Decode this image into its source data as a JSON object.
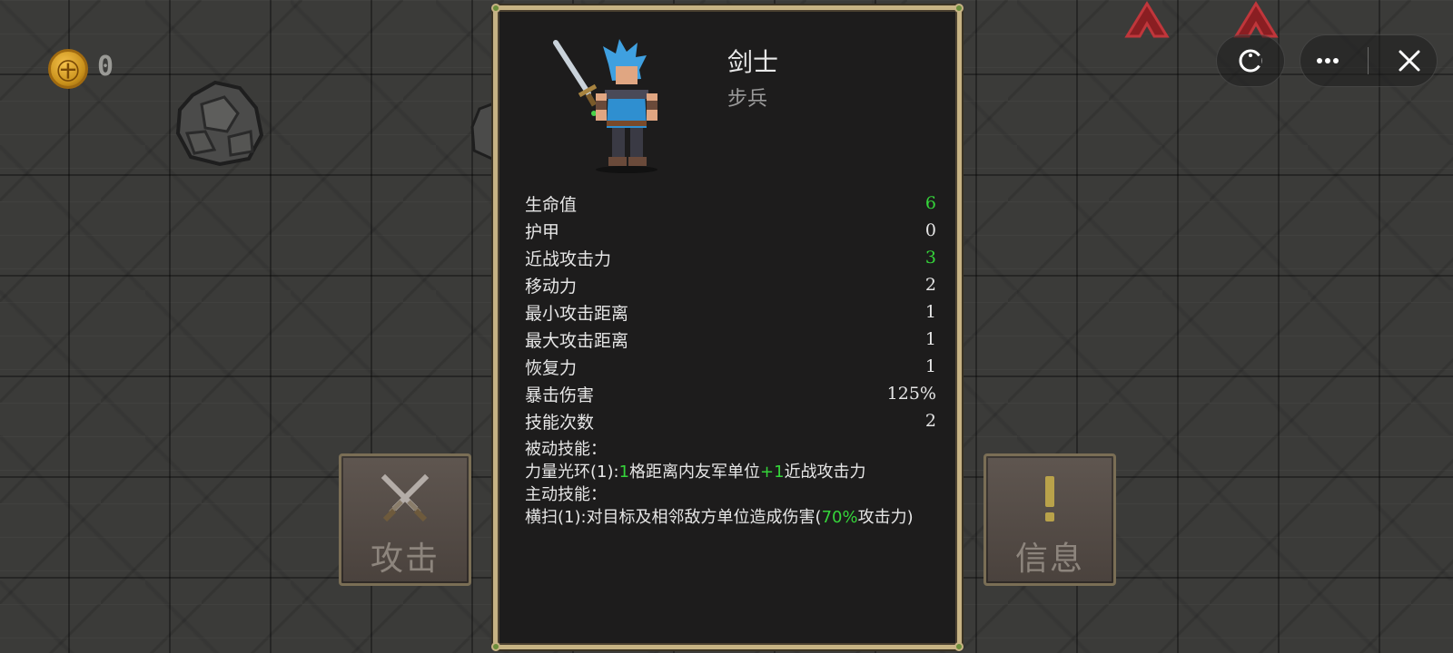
{
  "hud": {
    "coin_symbol": "㊉",
    "coin_count": "0"
  },
  "capsule": {
    "game_icon": "pacman-icon",
    "more_icon": "more-dots-icon",
    "close_icon": "close-icon"
  },
  "actions": {
    "attack_label": "攻击",
    "attack_icon": "crossed-swords-icon",
    "info_label": "信息",
    "info_icon": "exclamation-icon"
  },
  "unit": {
    "name": "剑士",
    "type": "步兵",
    "stats": [
      {
        "label": "生命值",
        "value": "6",
        "highlight": true
      },
      {
        "label": "护甲",
        "value": "0",
        "highlight": false
      },
      {
        "label": "近战攻击力",
        "value": "3",
        "highlight": true
      },
      {
        "label": "移动力",
        "value": "2",
        "highlight": false
      },
      {
        "label": "最小攻击距离",
        "value": "1",
        "highlight": false
      },
      {
        "label": "最大攻击距离",
        "value": "1",
        "highlight": false
      },
      {
        "label": "恢复力",
        "value": "1",
        "highlight": false
      },
      {
        "label": "暴击伤害",
        "value": "125%",
        "highlight": false
      },
      {
        "label": "技能次数",
        "value": "2",
        "highlight": false
      }
    ],
    "passive_heading": "被动技能：",
    "passive": {
      "name": "力量光环(1):",
      "range": "1",
      "mid": "格距离内友军单位",
      "bonus": "+1",
      "tail": "近战攻击力"
    },
    "active_heading": "主动技能：",
    "active": {
      "name": "横扫(1):",
      "desc": "对目标及相邻敌方单位造成伤害(",
      "pct": "70%",
      "tail": "攻击力)"
    }
  },
  "colors": {
    "highlight": "#35d43a",
    "panel_border": "#c7b384",
    "panel_bg": "#1d1c1c"
  }
}
